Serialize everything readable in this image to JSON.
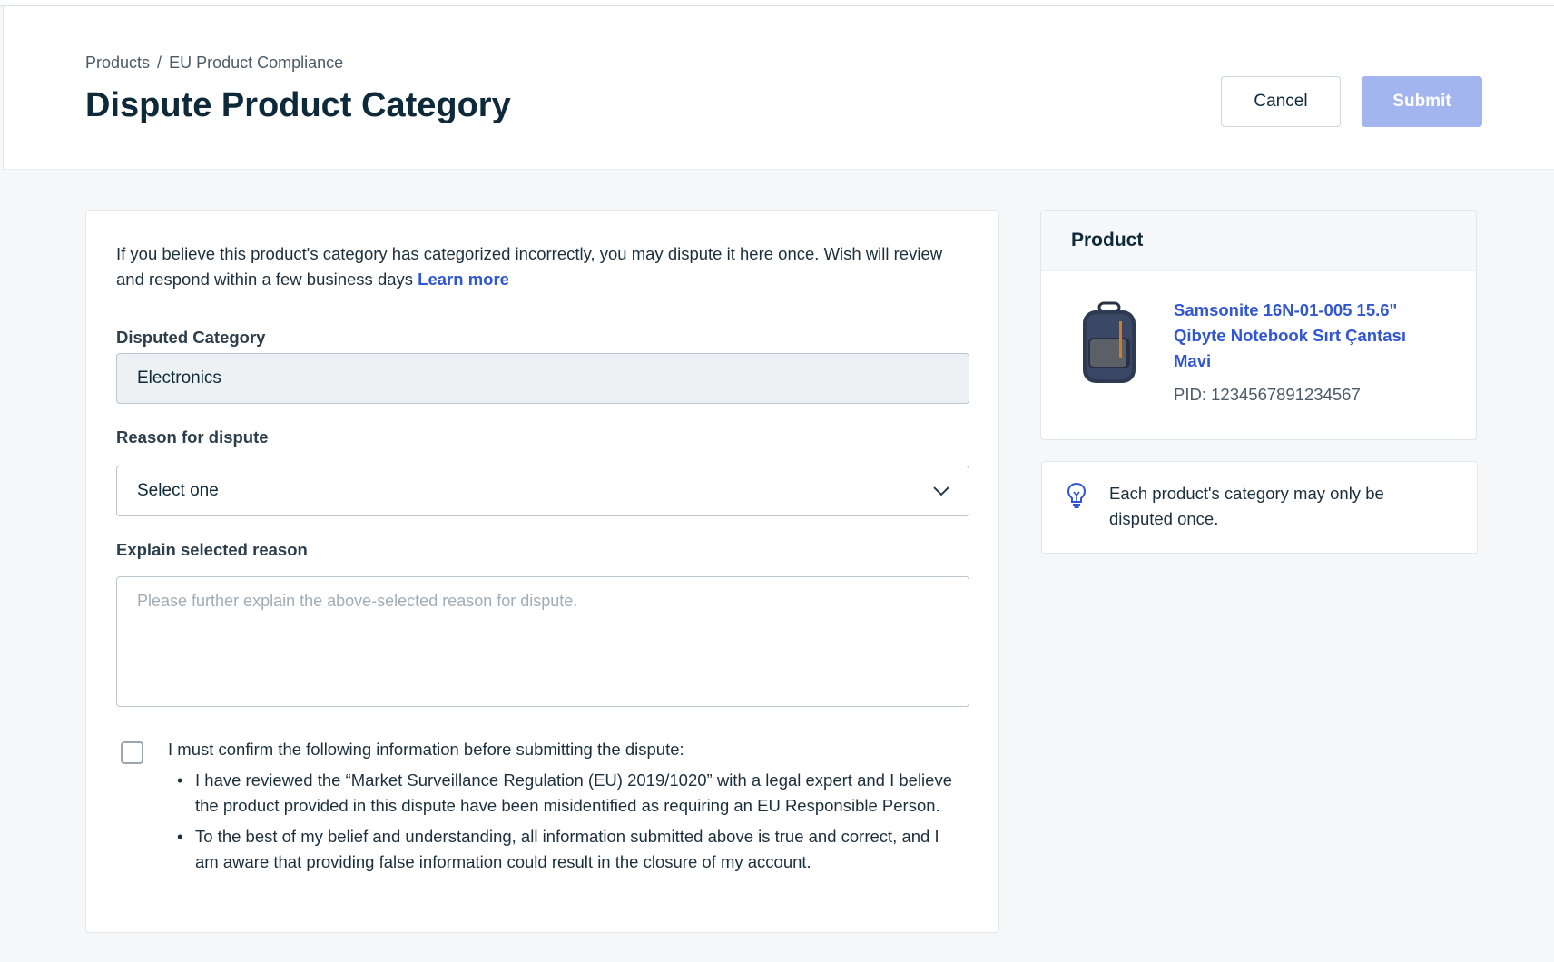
{
  "header": {
    "breadcrumb": [
      "Products",
      "EU Product Compliance"
    ],
    "breadcrumb_sep": "/",
    "title": "Dispute Product Category",
    "cancel_label": "Cancel",
    "submit_label": "Submit"
  },
  "form": {
    "intro": "If you believe this product's category has categorized incorrectly, you may dispute it here once. Wish will review and respond within a few business days",
    "learn_more": "Learn more",
    "disputed_category_label": "Disputed Category",
    "disputed_category_value": "Electronics",
    "reason_label": "Reason for dispute",
    "reason_value": "Select one",
    "explain_label": "Explain selected reason",
    "explain_placeholder": "Please further explain the above-selected reason for dispute.",
    "confirm_intro": "I must confirm the following information before submitting the dispute:",
    "confirm_items": [
      "I have reviewed the “Market Surveillance Regulation (EU) 2019/1020” with a legal expert and I believe the product provided in this dispute have been misidentified as requiring an EU Responsible Person.",
      "To the best of my belief and understanding, all information submitted above is true and correct, and I am aware that providing false information could result in the closure of my account."
    ]
  },
  "product": {
    "heading": "Product",
    "name": "Samsonite 16N-01-005 15.6\" Qibyte Notebook Sırt Çantası Mavi",
    "pid": "PID: 1234567891234567"
  },
  "tip": {
    "icon": "lightbulb-icon",
    "text": "Each product's category may only be disputed once."
  },
  "colors": {
    "accent": "#3056d3",
    "submit_disabled": "#a3b5ef"
  }
}
